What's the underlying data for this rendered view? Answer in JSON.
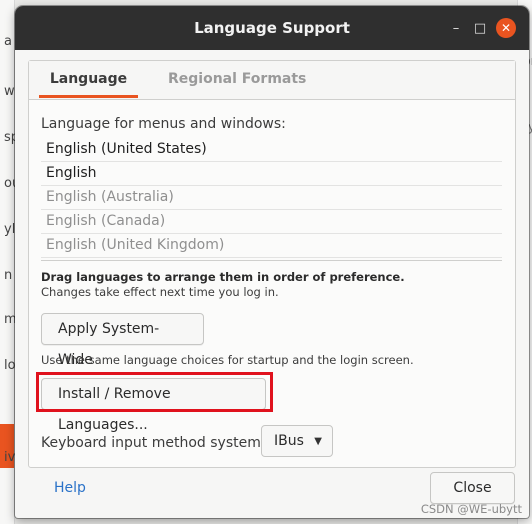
{
  "background": {
    "left_fragments": [
      "a",
      "w",
      "sp",
      "ou",
      "yl",
      "n",
      "m",
      "lo",
      "iv"
    ],
    "right_fragments": [
      "ion",
      "ity",
      "C",
      "g",
      "u"
    ]
  },
  "window": {
    "title": "Language Support",
    "minimize_glyph": "–",
    "maximize_glyph": "□",
    "close_glyph": "✕",
    "accent_color": "#e95420"
  },
  "tabs": [
    {
      "label": "Language",
      "selected": true
    },
    {
      "label": "Regional Formats",
      "selected": false
    }
  ],
  "language": {
    "section_label": "Language for menus and windows:",
    "languages": [
      {
        "name": "English (United States)",
        "active": true
      },
      {
        "name": "English",
        "active": true
      },
      {
        "name": "English (Australia)",
        "active": false
      },
      {
        "name": "English (Canada)",
        "active": false
      },
      {
        "name": "English (United Kingdom)",
        "active": false
      }
    ],
    "drag_hint_bold": "Drag languages to arrange them in order of preference.",
    "drag_hint": "Changes take effect next time you log in.",
    "apply_button": "Apply System-Wide",
    "apply_description": "Use the same language choices for startup and the login screen.",
    "install_button": "Install / Remove Languages...",
    "keyboard_label": "Keyboard input method system:",
    "keyboard_value": "IBus",
    "dropdown_arrow": "▼"
  },
  "footer": {
    "help": "Help",
    "close": "Close"
  },
  "watermark": "CSDN @WE-ubytt"
}
